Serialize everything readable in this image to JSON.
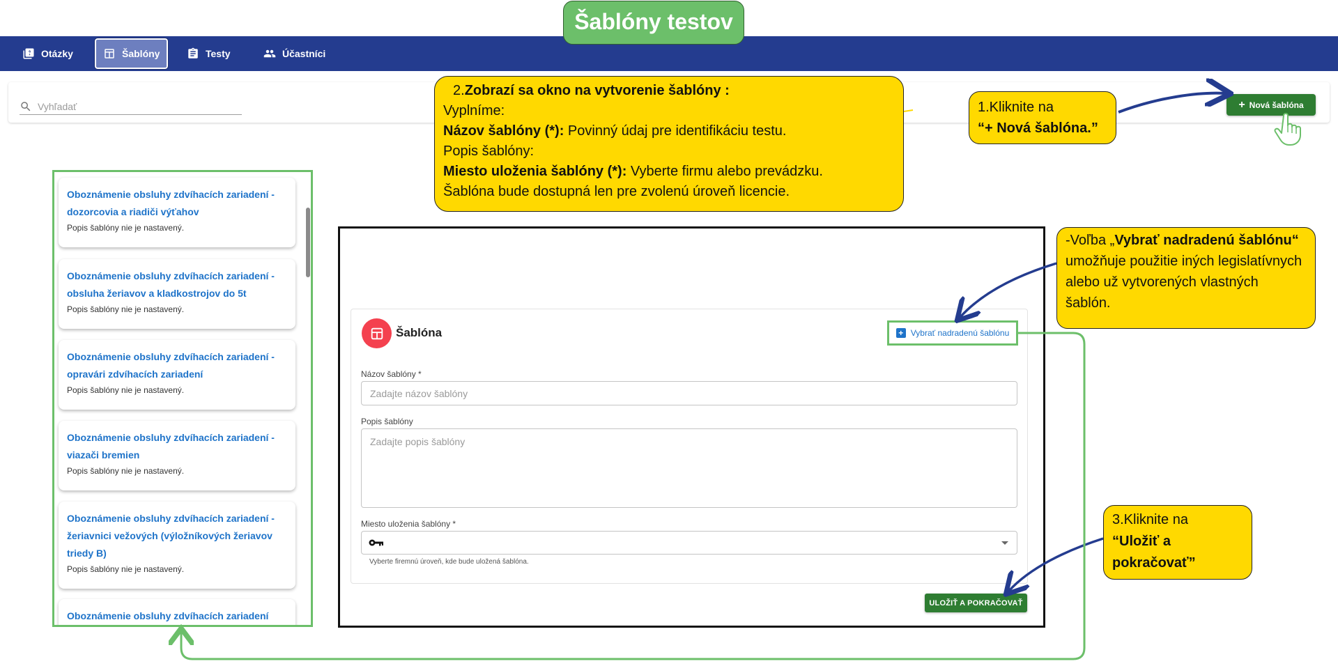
{
  "banner": {
    "title": "Šablóny testov"
  },
  "nav": {
    "items": [
      {
        "label": "Otázky"
      },
      {
        "label": "Šablóny"
      },
      {
        "label": "Testy"
      },
      {
        "label": "Účastníci"
      }
    ]
  },
  "search": {
    "placeholder": "Vyhľadať"
  },
  "toolbar": {
    "new_template_label": "Nová šablóna"
  },
  "callouts": {
    "step2": {
      "num": "2.",
      "heading": "Zobrazí sa okno na vytvorenie šablóny :",
      "line1": "Vyplníme:",
      "name_bold": "Názov šablóny (*):",
      "name_text": " Povinný údaj pre identifikáciu testu.",
      "desc_line": "Popis šablóny:",
      "loc_bold": "Miesto uloženia šablóny (*):",
      "loc_text": " Vyberte firmu alebo prevádzku.",
      "loc_line2": "Šablóna bude dostupná len pre zvolenú úroveň licencie."
    },
    "step1": {
      "line1": "1.Kliknite na",
      "line2_bold": "“+ Nová šablóna.”"
    },
    "parent": {
      "prefix": "-Voľba „",
      "bold": "Vybrať nadradenú šablónu“",
      "text": " umožňuje použitie iných legislatívnych alebo už vytvorených vlastných šablón."
    },
    "step3": {
      "line1": "3.Kliknite na",
      "bold": "“Uložiť a pokračovať”"
    }
  },
  "templates": [
    {
      "title": "Oboznámenie obsluhy zdvíhacích zariadení - dozorcovia a riadiči výťahov",
      "desc": "Popis šablóny nie je nastavený."
    },
    {
      "title": "Oboznámenie obsluhy zdvíhacích zariadení - obsluha žeriavov a kladkostrojov do 5t",
      "desc": "Popis šablóny nie je nastavený."
    },
    {
      "title": "Oboznámenie obsluhy zdvíhacích zariadení - opravári zdvíhacích zariadení",
      "desc": "Popis šablóny nie je nastavený."
    },
    {
      "title": "Oboznámenie obsluhy zdvíhacích zariadení - viazači bremien",
      "desc": "Popis šablóny nie je nastavený."
    },
    {
      "title": "Oboznámenie obsluhy zdvíhacích zariadení - žeriavnici vežových (výložníkových žeriavov triedy B)",
      "desc": "Popis šablóny nie je nastavený."
    },
    {
      "title": "Oboznámenie obsluhy zdvíhacích zariadení",
      "desc": ""
    }
  ],
  "form": {
    "title": "Šablóna",
    "parent_button": "Vybrať nadradenú šablónu",
    "name_label": "Názov šablóny *",
    "name_placeholder": "Zadajte názov šablóny",
    "desc_label": "Popis šablóny",
    "desc_placeholder": "Zadajte popis šablóny",
    "location_label": "Miesto uloženia šablóny *",
    "location_helper": "Vyberte firemnú úroveň, kde bude uložená šablóna.",
    "save_label": "ULOŽIŤ A POKRAČOVAŤ"
  },
  "colors": {
    "nav": "#243c8f",
    "accent_green": "#2e7d32",
    "callout": "#ffd900",
    "frame_green": "#6cbf6a",
    "link_blue": "#1e73c9"
  }
}
